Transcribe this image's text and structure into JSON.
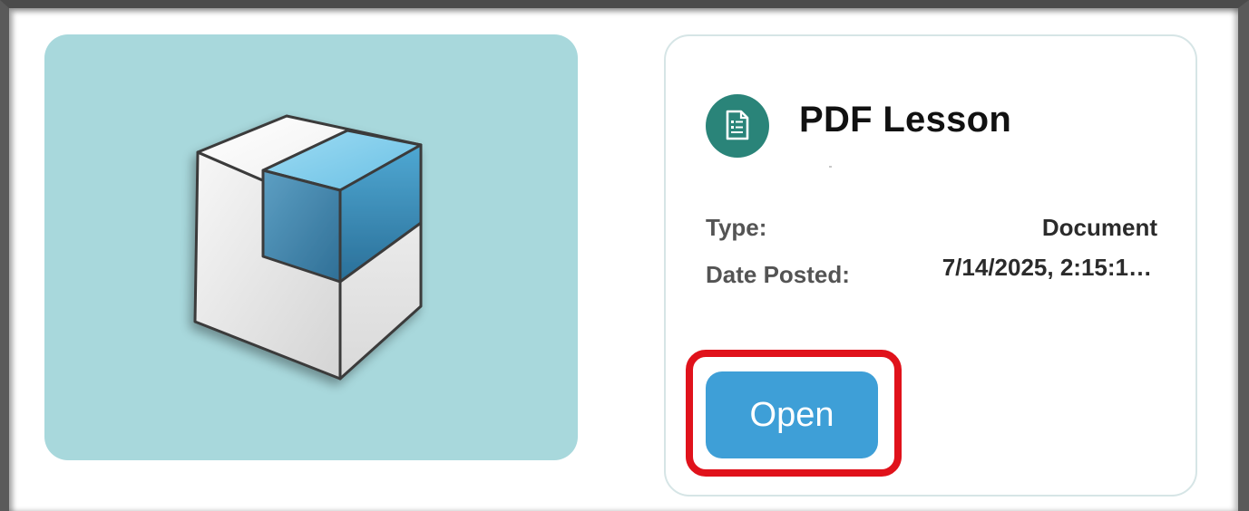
{
  "lesson": {
    "title": "PDF Lesson",
    "thumbnail_icon": "3d-cube-icon",
    "badge_icon": "document-icon",
    "badge_color": "#2a8479",
    "thumbnail_bg": "#a8d8dc"
  },
  "details": {
    "type_label": "Type:",
    "type_value": "Document",
    "date_label": "Date Posted:",
    "date_value": "7/14/2025, 2:15:1…"
  },
  "actions": {
    "open_label": "Open",
    "open_color": "#3e9fd7",
    "highlight_color": "#e0121b"
  }
}
